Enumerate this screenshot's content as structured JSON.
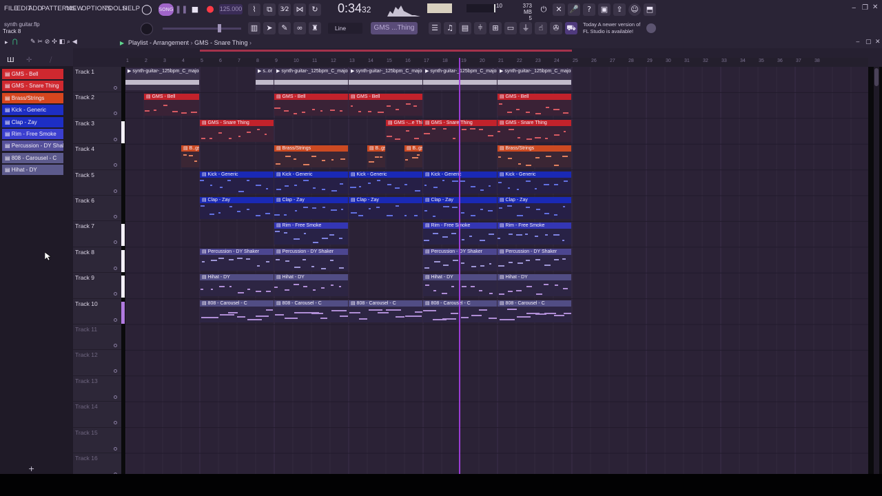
{
  "menu": [
    "FILE",
    "EDIT",
    "ADD",
    "PATTERNS",
    "VIEW",
    "OPTIONS",
    "TOOLS",
    "HELP"
  ],
  "hint": {
    "title": "synth guitar.flp",
    "subtitle": "Track 8"
  },
  "tempo": "125.000",
  "time": {
    "main": "0:34",
    "sub": "32"
  },
  "cpu": "10",
  "memory": {
    "mb": "373 MB",
    "voices": "5"
  },
  "snap": "Line",
  "pattern": "GMS ...Thing",
  "news": {
    "line1": "Today  A newer version of",
    "line2": "FL Studio is available!"
  },
  "playlist": {
    "title": "Playlist - Arrangement",
    "pattern": "GMS - Snare Thing"
  },
  "channels": [
    {
      "label": "GMS - Bell",
      "color": "#d0282f"
    },
    {
      "label": "GMS - Snare Thing",
      "color": "#d0282f"
    },
    {
      "label": "Brass/Strings",
      "color": "#d6461e"
    },
    {
      "label": "Kick - Generic",
      "color": "#1d2ec4"
    },
    {
      "label": "Clap - Zay",
      "color": "#1d2ec4"
    },
    {
      "label": "Rim - Free Smoke",
      "color": "#3b3fcf"
    },
    {
      "label": "Percussion - DY Shaker",
      "color": "#55509a"
    },
    {
      "label": "808 - Carousel - C",
      "color": "#5c5a8c"
    },
    {
      "label": "Hihat - DY",
      "color": "#5c5a8c"
    }
  ],
  "tracks": [
    "Track 1",
    "Track 2",
    "Track 3",
    "Track 4",
    "Track 5",
    "Track 6",
    "Track 7",
    "Track 8",
    "Track 9",
    "Track 10",
    "Track 11",
    "Track 12",
    "Track 13",
    "Track 14",
    "Track 15",
    "Track 16"
  ],
  "bars": [
    "1",
    "2",
    "3",
    "4",
    "5",
    "6",
    "7",
    "8",
    "9",
    "10",
    "11",
    "12",
    "13",
    "14",
    "15",
    "16",
    "17",
    "18",
    "19",
    "20",
    "21",
    "22",
    "23",
    "24",
    "25",
    "26",
    "27",
    "28",
    "29",
    "30",
    "31",
    "32",
    "33",
    "34",
    "35",
    "36",
    "37",
    "38"
  ],
  "clips": [
    {
      "track": 0,
      "start": 1,
      "len": 4,
      "label": "synth-guitar-_125bpm_C_major",
      "kind": "audio"
    },
    {
      "track": 0,
      "start": 8,
      "len": 1,
      "label": "s..or",
      "kind": "audio"
    },
    {
      "track": 0,
      "start": 9,
      "len": 4,
      "label": "synth-guitar-_125bpm_C_major",
      "kind": "audio"
    },
    {
      "track": 0,
      "start": 13,
      "len": 4,
      "label": "synth-guitar-_125bpm_C_major",
      "kind": "audio"
    },
    {
      "track": 0,
      "start": 17,
      "len": 4,
      "label": "synth-guitar-_125bpm_C_major",
      "kind": "audio"
    },
    {
      "track": 0,
      "start": 21,
      "len": 4,
      "label": "synth-guitar-_125bpm_C_major",
      "kind": "audio"
    },
    {
      "track": 1,
      "start": 2,
      "len": 3,
      "label": "GMS - Bell",
      "kind": "red"
    },
    {
      "track": 1,
      "start": 9,
      "len": 4,
      "label": "GMS - Bell",
      "kind": "red"
    },
    {
      "track": 1,
      "start": 13,
      "len": 4,
      "label": "GMS - Bell",
      "kind": "red"
    },
    {
      "track": 1,
      "start": 21,
      "len": 4,
      "label": "GMS - Bell",
      "kind": "red"
    },
    {
      "track": 2,
      "start": 5,
      "len": 4,
      "label": "GMS - Snare Thing",
      "kind": "red"
    },
    {
      "track": 2,
      "start": 15,
      "len": 2,
      "label": "GMS -...e Thing",
      "kind": "red"
    },
    {
      "track": 2,
      "start": 17,
      "len": 4,
      "label": "GMS - Snare Thing",
      "kind": "red"
    },
    {
      "track": 2,
      "start": 21,
      "len": 4,
      "label": "GMS - Snare Thing",
      "kind": "red"
    },
    {
      "track": 3,
      "start": 4,
      "len": 1,
      "label": "B..gs",
      "kind": "orange"
    },
    {
      "track": 3,
      "start": 9,
      "len": 4,
      "label": "Brass/Strings",
      "kind": "orange"
    },
    {
      "track": 3,
      "start": 14,
      "len": 1,
      "label": "B..gs",
      "kind": "orange"
    },
    {
      "track": 3,
      "start": 16,
      "len": 1,
      "label": "B..gs",
      "kind": "orange"
    },
    {
      "track": 3,
      "start": 21,
      "len": 4,
      "label": "Brass/Strings",
      "kind": "orange"
    },
    {
      "track": 4,
      "start": 5,
      "len": 4,
      "label": "Kick - Generic",
      "kind": "blue"
    },
    {
      "track": 4,
      "start": 9,
      "len": 4,
      "label": "Kick - Generic",
      "kind": "blue"
    },
    {
      "track": 4,
      "start": 13,
      "len": 4,
      "label": "Kick - Generic",
      "kind": "blue"
    },
    {
      "track": 4,
      "start": 17,
      "len": 4,
      "label": "Kick - Generic",
      "kind": "blue"
    },
    {
      "track": 4,
      "start": 21,
      "len": 4,
      "label": "Kick - Generic",
      "kind": "blue"
    },
    {
      "track": 5,
      "start": 5,
      "len": 4,
      "label": "Clap - Zay",
      "kind": "blue"
    },
    {
      "track": 5,
      "start": 9,
      "len": 4,
      "label": "Clap - Zay",
      "kind": "blue"
    },
    {
      "track": 5,
      "start": 13,
      "len": 4,
      "label": "Clap - Zay",
      "kind": "blue"
    },
    {
      "track": 5,
      "start": 17,
      "len": 4,
      "label": "Clap - Zay",
      "kind": "blue"
    },
    {
      "track": 5,
      "start": 21,
      "len": 4,
      "label": "Clap - Zay",
      "kind": "blue"
    },
    {
      "track": 6,
      "start": 9,
      "len": 4,
      "label": "Rim - Free Smoke",
      "kind": "indigo"
    },
    {
      "track": 6,
      "start": 17,
      "len": 4,
      "label": "Rim - Free Smoke",
      "kind": "indigo"
    },
    {
      "track": 6,
      "start": 21,
      "len": 4,
      "label": "Rim - Free Smoke",
      "kind": "indigo"
    },
    {
      "track": 7,
      "start": 5,
      "len": 4,
      "label": "Percussion - DY Shaker",
      "kind": "violet"
    },
    {
      "track": 7,
      "start": 9,
      "len": 4,
      "label": "Percussion - DY Shaker",
      "kind": "violet"
    },
    {
      "track": 7,
      "start": 17,
      "len": 4,
      "label": "Percussion - DY Shaker",
      "kind": "violet"
    },
    {
      "track": 7,
      "start": 21,
      "len": 4,
      "label": "Percussion - DY Shaker",
      "kind": "violet"
    },
    {
      "track": 8,
      "start": 5,
      "len": 4,
      "label": "Hihat - DY",
      "kind": "slate"
    },
    {
      "track": 8,
      "start": 9,
      "len": 4,
      "label": "Hihat - DY",
      "kind": "slate"
    },
    {
      "track": 8,
      "start": 17,
      "len": 4,
      "label": "Hihat - DY",
      "kind": "slate"
    },
    {
      "track": 8,
      "start": 21,
      "len": 4,
      "label": "Hihat - DY",
      "kind": "slate"
    },
    {
      "track": 9,
      "start": 5,
      "len": 4,
      "label": "808 - Carousel - C",
      "kind": "slate"
    },
    {
      "track": 9,
      "start": 9,
      "len": 4,
      "label": "808 - Carousel - C",
      "kind": "slate"
    },
    {
      "track": 9,
      "start": 13,
      "len": 4,
      "label": "808 - Carousel - C",
      "kind": "slate"
    },
    {
      "track": 9,
      "start": 17,
      "len": 4,
      "label": "808 - Carousel - C",
      "kind": "slate"
    },
    {
      "track": 9,
      "start": 21,
      "len": 4,
      "label": "808 - Carousel - C",
      "kind": "slate"
    }
  ],
  "clip_colors": {
    "audio": {
      "head": "#3c3350",
      "body": "#3a3149",
      "note": "#d9d3e3"
    },
    "red": {
      "head": "#c2222b",
      "body": "#3a2236",
      "note": "#d65a62"
    },
    "orange": {
      "head": "#cc4a22",
      "body": "#3b2634",
      "note": "#e0805f"
    },
    "blue": {
      "head": "#1a29b5",
      "body": "#261f46",
      "note": "#6270e0"
    },
    "indigo": {
      "head": "#3436b4",
      "body": "#282246",
      "note": "#7f83e0"
    },
    "violet": {
      "head": "#4c4690",
      "body": "#2c2444",
      "note": "#9f97d6"
    },
    "slate": {
      "head": "#514d84",
      "body": "#2d2543",
      "note": "#b08ed6"
    }
  },
  "toolbar_icons": [
    "metronome-icon",
    "record-icon",
    "stop-icon",
    "play-icon",
    "loop-icon",
    "step-icon",
    "pattern-song-icon",
    "cpu-icon",
    "undo-icon",
    "redo-icon",
    "help-icon",
    "save-icon",
    "export-icon",
    "chat-icon",
    "minimize-icon",
    "restore-icon",
    "close-icon"
  ]
}
